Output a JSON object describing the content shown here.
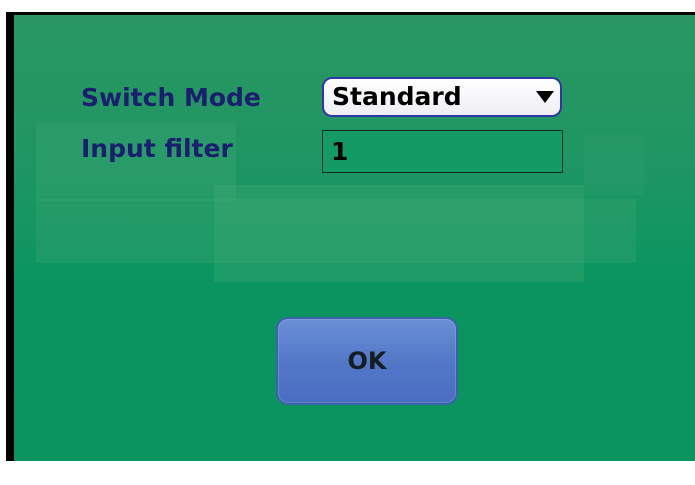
{
  "dialog": {
    "switch_mode": {
      "label": "Switch Mode",
      "selected_value": "Standard",
      "arrow_icon": "triangle-down-icon"
    },
    "input_filter": {
      "label": "Input filter",
      "value": "1"
    },
    "ok_button": {
      "label": "OK"
    }
  },
  "colors": {
    "background_green": "#0b9460",
    "label_text": "#1b1d6e",
    "button_blue": "#5378c8"
  }
}
